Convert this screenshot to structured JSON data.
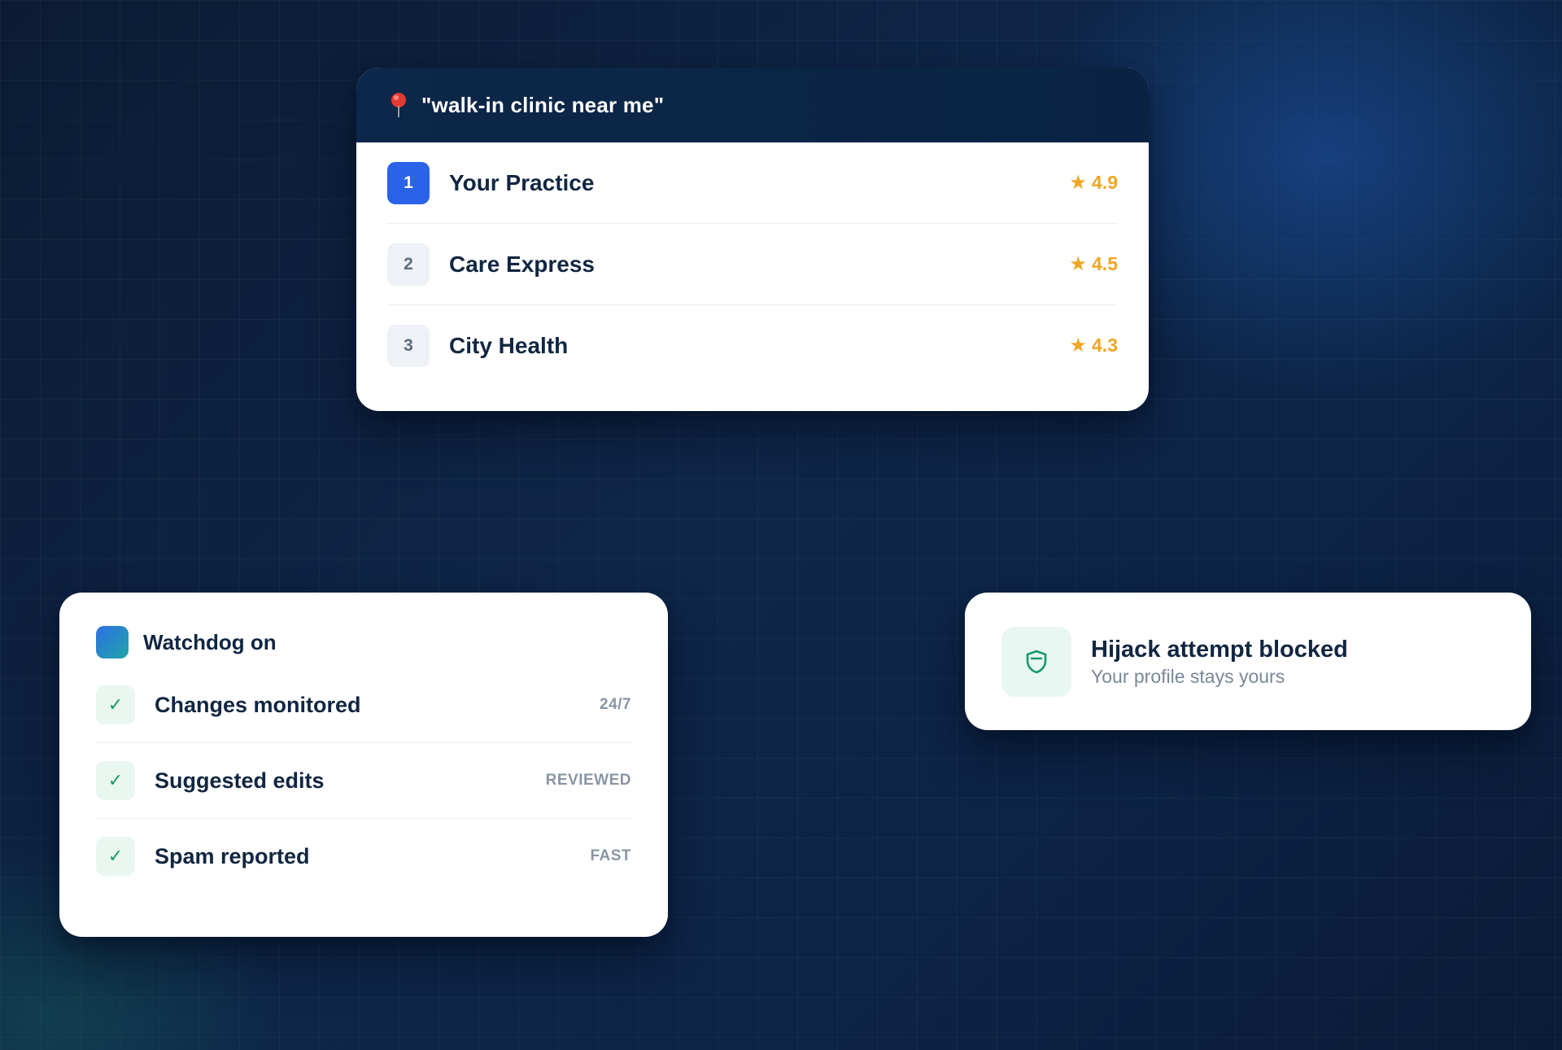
{
  "search": {
    "query": "\"walk-in clinic near me\"",
    "pin_icon": "map-pin-icon",
    "results": [
      {
        "rank": "1",
        "name": "Your Practice",
        "rating": "4.9",
        "highlighted": true
      },
      {
        "rank": "2",
        "name": "Care Express",
        "rating": "4.5",
        "highlighted": false
      },
      {
        "rank": "3",
        "name": "City Health",
        "rating": "4.3",
        "highlighted": false
      }
    ],
    "star_glyph": "★"
  },
  "watchdog": {
    "title": "Watchdog on",
    "check_glyph": "✓",
    "items": [
      {
        "label": "Changes monitored",
        "meta": "24/7"
      },
      {
        "label": "Suggested edits",
        "meta": "REVIEWED"
      },
      {
        "label": "Spam reported",
        "meta": "FAST"
      }
    ]
  },
  "alert": {
    "title": "Hijack attempt blocked",
    "subtitle": "Your profile stays yours",
    "icon": "shield-icon"
  },
  "colors": {
    "primary_blue": "#2a62e8",
    "rating_gold": "#efa624",
    "success_green": "#169a6a",
    "ink": "#112641",
    "background": "#0c2140"
  }
}
